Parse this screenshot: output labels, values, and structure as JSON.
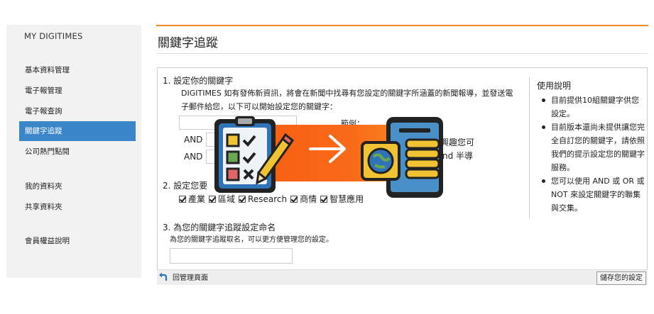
{
  "sidebar": {
    "title": "MY DIGITIMES",
    "items": [
      {
        "label": "基本資料管理"
      },
      {
        "label": "電子報管理"
      },
      {
        "label": "電子報查詢"
      },
      {
        "label": "關鍵字追蹤",
        "active": true
      },
      {
        "label": "公司熱門點閱"
      },
      {
        "label": "我的資料夾"
      },
      {
        "label": "共享資料夾"
      },
      {
        "label": "會員權益說明"
      }
    ]
  },
  "header": {
    "title": "關鍵字追蹤",
    "accent_color": "#ee8a22"
  },
  "section1": {
    "title": "1. 設定你的關鍵字",
    "desc_line1": "DIGITIMES 如有發佈新資訊，將會在新聞中找尋有您設定的關鍵字所涵蓋的新聞報導，並發送電",
    "desc_line2": "子郵件給您，以下可以開始設定您的關鍵字：",
    "operators": [
      "AND",
      "AND"
    ],
    "example_label": "範例：",
    "example_line1_fragment": "興趣您可",
    "example_line2_fragment": "nd 半導"
  },
  "section2": {
    "title": "2. 設定您要",
    "categories": [
      "產業",
      "區域",
      "Research",
      "商情",
      "智慧應用"
    ]
  },
  "section3": {
    "title": "3. 為您的關鍵字追蹤設定命名",
    "hint": "為您的關鍵字追蹤取名，可以更方便管理您的設定。"
  },
  "help": {
    "title": "使用說明",
    "items": [
      "目前提供10組關鍵字供您設定。",
      "目前版本還尚未提供讓您完全自訂您的關鍵字，請依照我們的提示設定您的關鍵字服務。",
      "您可以使用 AND 或 OR 或 NOT 來設定關鍵字的聯集與交集。"
    ]
  },
  "footer": {
    "back_label": "回管理頁面",
    "save_label": "儲存您的設定"
  },
  "overlay": {
    "icons": [
      "checklist-clipboard-icon",
      "pencil-icon",
      "arrow-right-icon",
      "smartphone-icon",
      "globe-icon",
      "database-icon"
    ],
    "banner_color": "#f86012"
  }
}
